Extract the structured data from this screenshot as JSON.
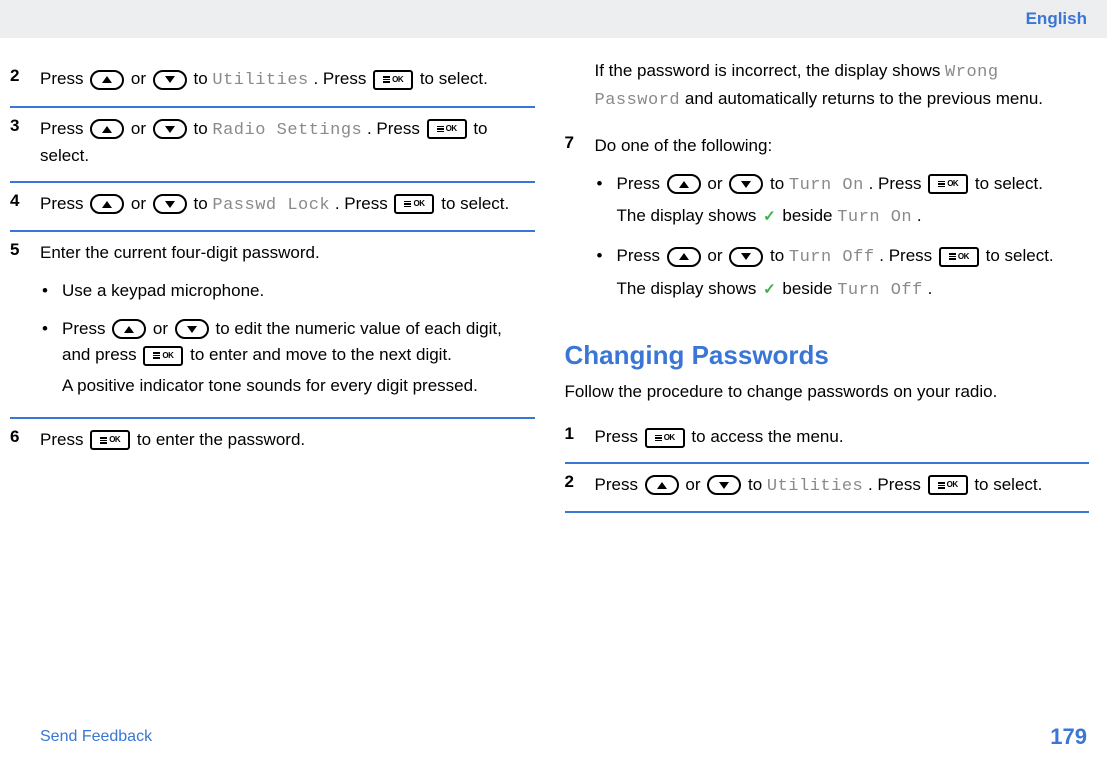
{
  "header": {
    "language": "English"
  },
  "left": {
    "s2": {
      "num": "2",
      "t1": "Press ",
      "or": " or ",
      "t2": " to ",
      "menu": "Utilities",
      "t3": ". Press ",
      "t4": " to select."
    },
    "s3": {
      "num": "3",
      "t1": "Press ",
      "or": " or ",
      "t2": " to ",
      "menu": "Radio Settings",
      "t3": ". Press ",
      "t4": " to select."
    },
    "s4": {
      "num": "4",
      "t1": "Press ",
      "or": " or ",
      "t2": " to ",
      "menu": "Passwd Lock",
      "t3": ". Press ",
      "t4": " to select."
    },
    "s5": {
      "num": "5",
      "intro": "Enter the current four-digit password.",
      "b1": "Use a keypad microphone.",
      "b2a": "Press ",
      "b2or": " or ",
      "b2b": " to edit the numeric value of each digit, and press ",
      "b2c": " to enter and move to the next digit.",
      "b2tone": "A positive indicator tone sounds for every digit pressed."
    },
    "s6": {
      "num": "6",
      "t1": "Press ",
      "t2": " to enter the password."
    }
  },
  "right": {
    "cont": {
      "t1": "If the password is incorrect, the display shows ",
      "wrong": "Wrong Password",
      "t2": " and automatically returns to the previous menu."
    },
    "s7": {
      "num": "7",
      "intro": "Do one of the following:",
      "on": {
        "t1": "Press ",
        "or": " or ",
        "t2": " to ",
        "menu": "Turn On",
        "t3": ". Press ",
        "t4": " to select.",
        "res1": "The display shows ",
        "res2": " beside ",
        "menu2": "Turn On",
        "dot": "."
      },
      "off": {
        "t1": "Press ",
        "or": " or ",
        "t2": " to ",
        "menu": "Turn Off",
        "t3": ". Press ",
        "t4": " to select.",
        "res1": "The display shows ",
        "res2": " beside ",
        "menu2": "Turn Off",
        "dot": "."
      }
    },
    "heading": "Changing Passwords",
    "intro": "Follow the procedure to change passwords on your radio.",
    "s1": {
      "num": "1",
      "t1": "Press ",
      "t2": " to access the menu."
    },
    "s2": {
      "num": "2",
      "t1": "Press ",
      "or": " or ",
      "t2": " to ",
      "menu": "Utilities",
      "t3": ". Press ",
      "t4": " to select."
    }
  },
  "footer": {
    "feedback": "Send Feedback",
    "page": "179"
  }
}
